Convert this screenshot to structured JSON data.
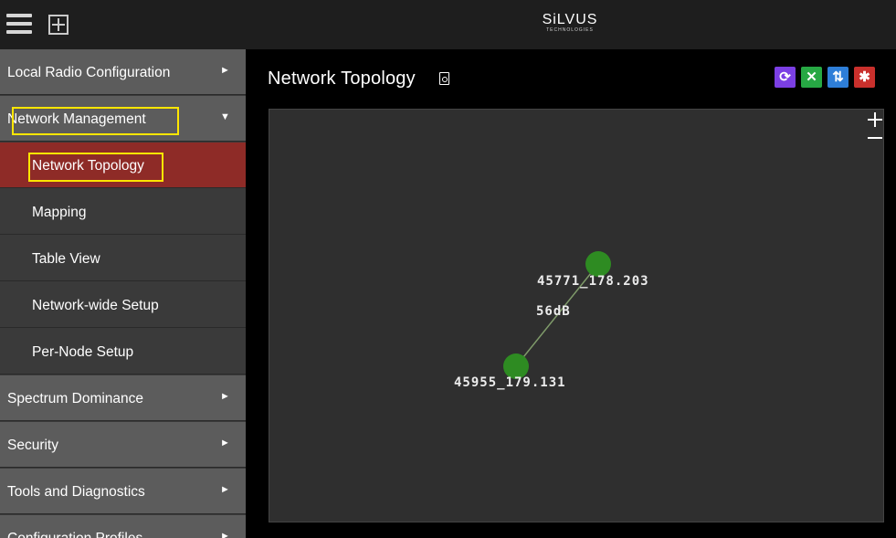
{
  "header": {
    "logo_line1": "SiLVUS",
    "logo_line2": "TECHNOLOGIES"
  },
  "sidebar": {
    "items": [
      {
        "label": "Local Radio Configuration",
        "arrow": "►"
      },
      {
        "label": "Network Management",
        "arrow": "▼"
      },
      {
        "label": "Network Topology"
      },
      {
        "label": "Mapping"
      },
      {
        "label": "Table View"
      },
      {
        "label": "Network-wide Setup"
      },
      {
        "label": "Per-Node Setup"
      },
      {
        "label": "Spectrum Dominance",
        "arrow": "►"
      },
      {
        "label": "Security",
        "arrow": "►"
      },
      {
        "label": "Tools and Diagnostics",
        "arrow": "►"
      },
      {
        "label": "Configuration Profiles",
        "arrow": "►"
      }
    ]
  },
  "main": {
    "title": "Network Topology",
    "toolbar": {
      "refresh_color": "#7b3fe4",
      "topology_color": "#27a844",
      "sort_color": "#2e7ed8",
      "settings_color": "#c9302c"
    }
  },
  "topology": {
    "node_color": "#2e8b22",
    "link_color": "#7f9b6a",
    "nodes": [
      {
        "id": "45771_178.203"
      },
      {
        "id": "45955_179.131"
      }
    ],
    "links": [
      {
        "label": "56dB"
      }
    ]
  }
}
